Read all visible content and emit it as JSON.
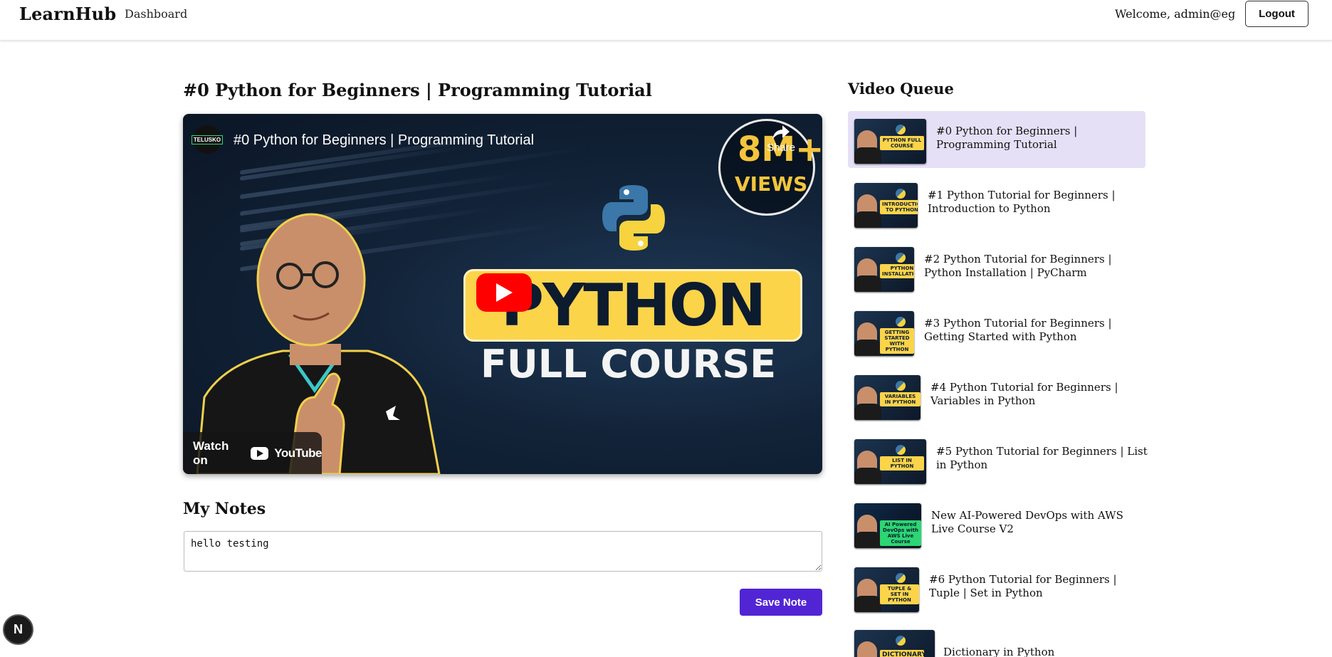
{
  "header": {
    "brand": "LearnHub",
    "nav_dashboard": "Dashboard",
    "welcome": "Welcome, admin@eg",
    "logout": "Logout"
  },
  "video": {
    "title": "#0 Python for Beginners | Programming Tutorial",
    "player_caption": "#0 Python for Beginners | Programming Tutorial",
    "channel_logo_text": "TELUSKO",
    "share_label": "Share",
    "views_badge_big": "8M+",
    "views_badge_small": "VIEWS",
    "thumb_line1": "PYTHON",
    "thumb_line2": "FULL COURSE",
    "watch_on": "Watch on",
    "youtube_word": "YouTube"
  },
  "notes": {
    "title": "My Notes",
    "value": "hello testing",
    "save_label": "Save Note"
  },
  "queue": {
    "title": "Video Queue",
    "items": [
      {
        "label": "#0 Python for Beginners | Programming Tutorial",
        "thumb_tag": "PYTHON FULL COURSE",
        "active": true
      },
      {
        "label": "#1 Python Tutorial for Beginners | Introduction to Python",
        "thumb_tag": "INTRODUCTION TO PYTHON",
        "active": false
      },
      {
        "label": "#2 Python Tutorial for Beginners | Python Installation | PyCharm",
        "thumb_tag": "PYTHON INSTALLATION",
        "active": false
      },
      {
        "label": "#3 Python Tutorial for Beginners | Getting Started with Python",
        "thumb_tag": "GETTING STARTED WITH PYTHON",
        "active": false
      },
      {
        "label": "#4 Python Tutorial for Beginners | Variables in Python",
        "thumb_tag": "VARIABLES IN PYTHON",
        "active": false
      },
      {
        "label": "#5 Python Tutorial for Beginners | List in Python",
        "thumb_tag": "LIST IN PYTHON",
        "active": false
      },
      {
        "label": "New AI-Powered DevOps with AWS Live Course V2",
        "thumb_tag": "AI Powered DevOps with AWS Live Course",
        "active": false
      },
      {
        "label": "#6 Python Tutorial for Beginners | Tuple | Set in Python",
        "thumb_tag": "TUPLE & SET IN PYTHON",
        "active": false
      },
      {
        "label": "Dictionary in Python",
        "thumb_tag": "DICTIONARY",
        "active": false
      }
    ]
  },
  "dev_badge": "N",
  "colors": {
    "accent": "#5225d4",
    "active_item": "#e6e0f7",
    "thumb_yellow": "#fbd44a"
  }
}
